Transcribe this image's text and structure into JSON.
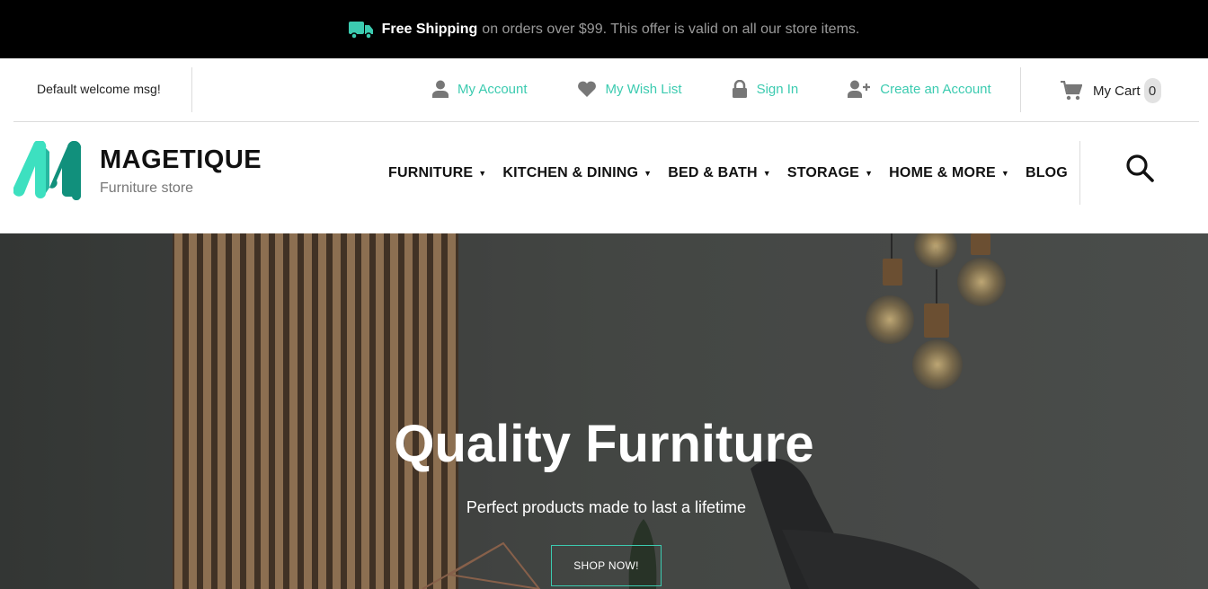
{
  "promo": {
    "icon": "truck-icon",
    "strong": "Free Shipping",
    "text": "on orders over $99. This offer is valid on all our store items."
  },
  "header": {
    "welcome": "Default welcome msg!",
    "links": [
      {
        "label": "My Account",
        "icon": "user-icon"
      },
      {
        "label": "My Wish List",
        "icon": "heart-icon"
      },
      {
        "label": "Sign In",
        "icon": "lock-icon"
      },
      {
        "label": "Create an Account",
        "icon": "add-user-icon"
      }
    ],
    "cart": {
      "label": "My Cart",
      "count": "0",
      "icon": "cart-icon"
    }
  },
  "logo": {
    "name": "MAGETIQUE",
    "tagline": "Furniture store"
  },
  "nav": [
    {
      "label": "FURNITURE",
      "dropdown": true
    },
    {
      "label": "KITCHEN & DINING",
      "dropdown": true
    },
    {
      "label": "BED & BATH",
      "dropdown": true
    },
    {
      "label": "STORAGE",
      "dropdown": true
    },
    {
      "label": "HOME & MORE",
      "dropdown": true
    },
    {
      "label": "BLOG",
      "dropdown": false
    }
  ],
  "hero": {
    "title": "Quality Furniture",
    "subtitle": "Perfect products made to last a lifetime",
    "button": "SHOP NOW!"
  },
  "colors": {
    "accent": "#3ccbb0",
    "promo_bg": "#000000",
    "hero_bg": "#4c4e4c"
  }
}
